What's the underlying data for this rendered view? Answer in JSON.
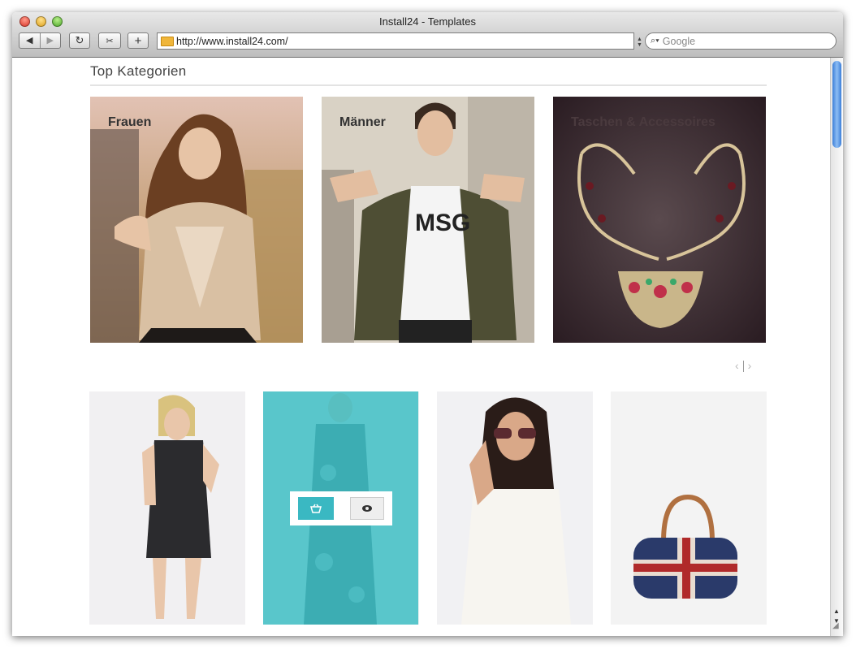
{
  "window": {
    "title": "Install24 - Templates"
  },
  "toolbar": {
    "back_icon": "◀",
    "forward_icon": "▶",
    "reload_icon": "↻",
    "snapback_icon": "✂",
    "add_bookmark_icon": "+",
    "url": "http://www.install24.com/",
    "search_icon": "🔍",
    "search_placeholder": "Google"
  },
  "page": {
    "heading": "Top Kategorien",
    "categories": [
      {
        "label": "Frauen"
      },
      {
        "label": "Männer"
      },
      {
        "label": "Taschen & Accessoires"
      }
    ],
    "pager": {
      "prev": "‹",
      "next": "›"
    }
  },
  "colors": {
    "accent": "#3ab8c2",
    "overlay": "#40bec4"
  },
  "icons": {
    "cart": "basket-icon",
    "view": "eye-icon"
  }
}
